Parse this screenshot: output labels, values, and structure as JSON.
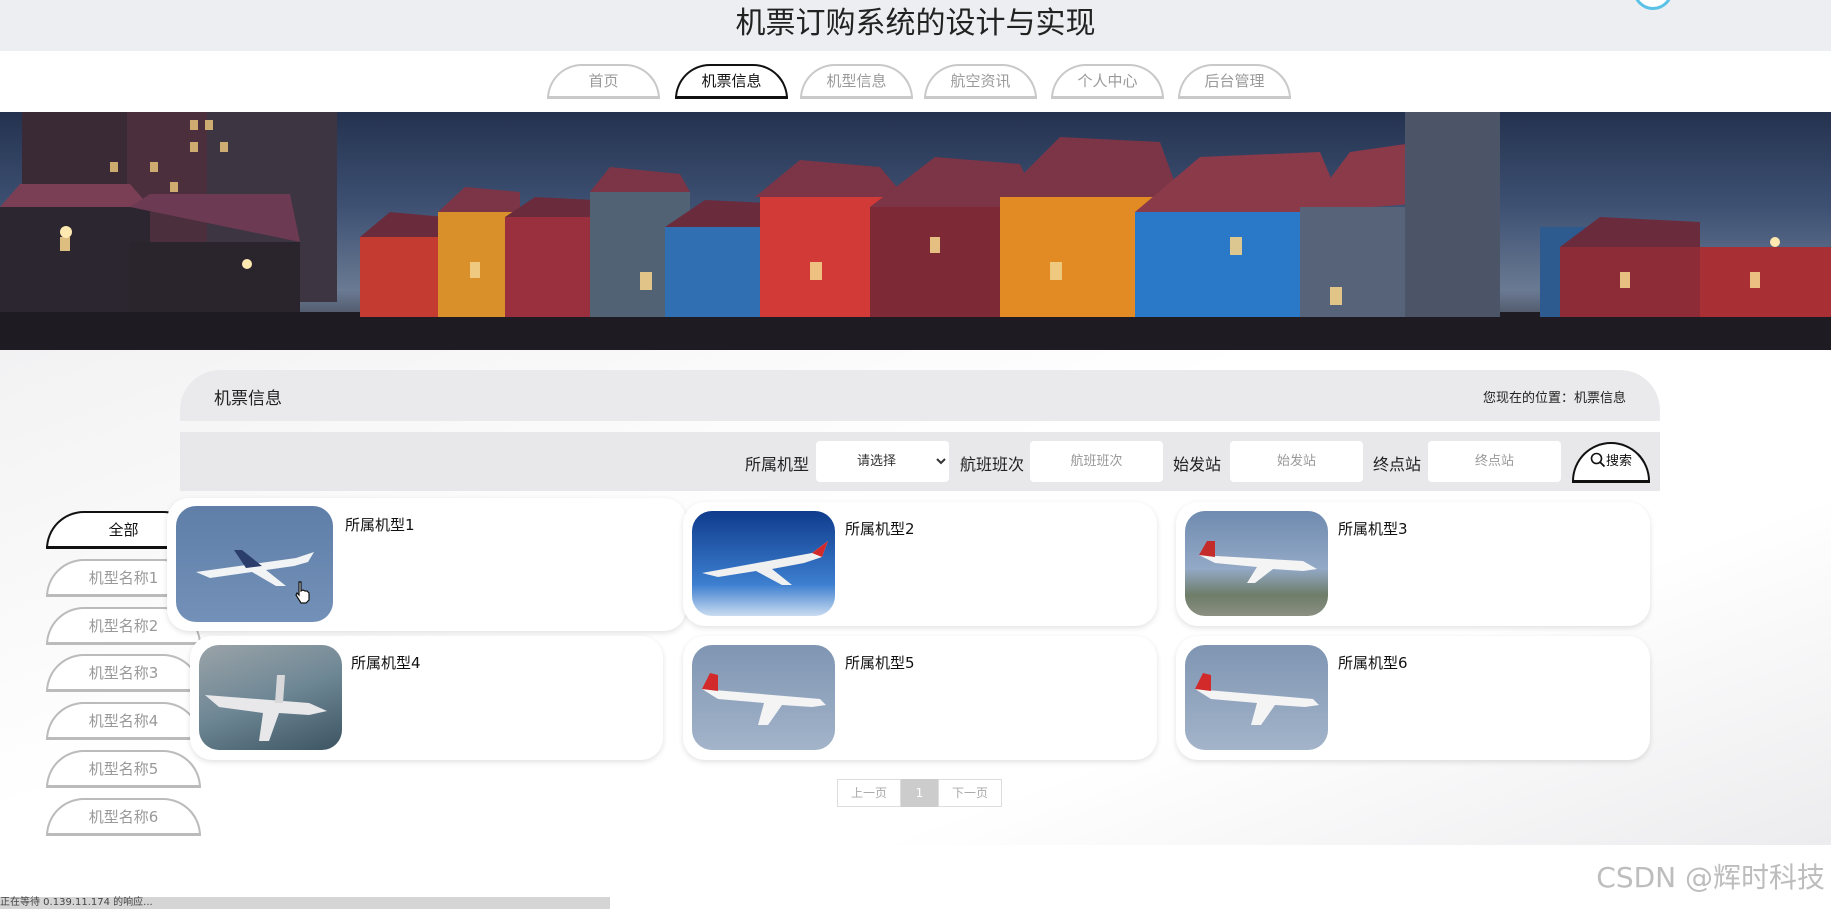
{
  "header": {
    "title": "机票订购系统的设计与实现"
  },
  "nav": {
    "items": [
      {
        "label": "首页"
      },
      {
        "label": "机票信息"
      },
      {
        "label": "机型信息"
      },
      {
        "label": "航空资讯"
      },
      {
        "label": "个人中心"
      },
      {
        "label": "后台管理"
      }
    ],
    "active_index": 1
  },
  "section": {
    "title": "机票信息",
    "location_label": "您现在的位置：",
    "location_value": "机票信息"
  },
  "search": {
    "type_label": "所属机型",
    "type_select": "请选择",
    "flight_label": "航班班次",
    "flight_placeholder": "航班班次",
    "origin_label": "始发站",
    "origin_placeholder": "始发站",
    "dest_label": "终点站",
    "dest_placeholder": "终点站",
    "button": "搜索",
    "button_icon": "search-icon"
  },
  "sidebar": {
    "items": [
      {
        "label": "全部"
      },
      {
        "label": "机型名称1"
      },
      {
        "label": "机型名称2"
      },
      {
        "label": "机型名称3"
      },
      {
        "label": "机型名称4"
      },
      {
        "label": "机型名称5"
      },
      {
        "label": "机型名称6"
      }
    ],
    "active_index": 0
  },
  "cards": [
    {
      "label": "所属机型1"
    },
    {
      "label": "所属机型2"
    },
    {
      "label": "所属机型3"
    },
    {
      "label": "所属机型4"
    },
    {
      "label": "所属机型5"
    },
    {
      "label": "所属机型6"
    }
  ],
  "pagination": {
    "prev": "上一页",
    "current": "1",
    "next": "下一页"
  },
  "footer": {
    "status": "正在等待 0.139.11.174 的响应...",
    "watermark": "CSDN @辉时科技"
  },
  "colors": {
    "accent": "#111111",
    "inactive": "#9a9a9a",
    "panel": "#eaeaec"
  }
}
